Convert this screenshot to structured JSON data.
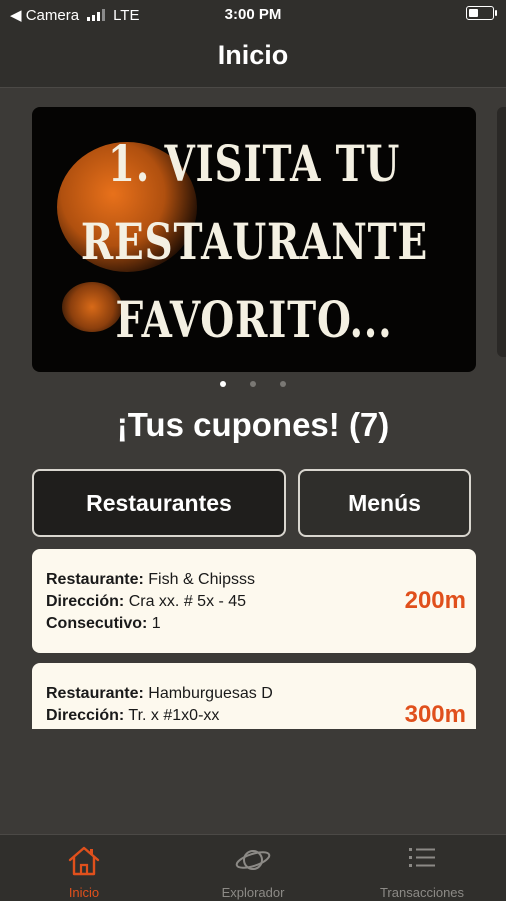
{
  "status_bar": {
    "carrier_back": "◀ Camera",
    "network": "LTE",
    "time": "3:00 PM",
    "battery_level": 0.4
  },
  "nav": {
    "title": "Inicio"
  },
  "banner": {
    "lines": [
      "1. VISITA TU",
      "RESTAURANTE",
      "FAVORITO..."
    ],
    "page_count": 3,
    "active_page": 1
  },
  "coupons": {
    "title": "¡Tus cupones! (7)",
    "tabs": [
      {
        "label": "Restaurantes",
        "active": true
      },
      {
        "label": "Menús",
        "active": false
      }
    ],
    "labels": {
      "restaurante": "Restaurante:",
      "direccion": "Dirección:",
      "consecutivo": "Consecutivo:"
    },
    "items": [
      {
        "restaurante": "Fish & Chipsss",
        "direccion": "Cra xx. # 5x - 45",
        "consecutivo": "1",
        "distancia": "200m"
      },
      {
        "restaurante": "Hamburguesas D",
        "direccion": "Tr. x #1x0-xx",
        "distancia": "300m"
      }
    ]
  },
  "tab_bar": {
    "items": [
      {
        "label": "Inicio",
        "icon": "home-icon",
        "active": true
      },
      {
        "label": "Explorador",
        "icon": "planet-icon",
        "active": false
      },
      {
        "label": "Transacciones",
        "icon": "list-icon",
        "active": false
      }
    ]
  },
  "colors": {
    "accent": "#e0501c",
    "background": "#3c3a37",
    "card": "#fdf9ee"
  }
}
